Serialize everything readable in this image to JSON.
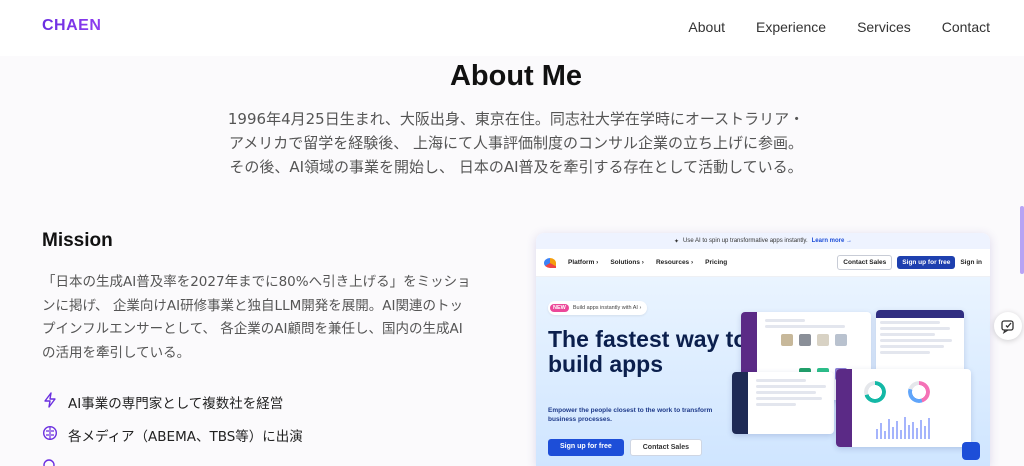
{
  "header": {
    "logo": "CHAEN",
    "nav": [
      "About",
      "Experience",
      "Services",
      "Contact"
    ]
  },
  "about": {
    "title": "About Me",
    "lines": [
      "1996年4月25日生まれ、大阪出身、東京在住。同志社大学在学時にオーストラリア・",
      "アメリカで留学を経験後、 上海にて人事評価制度のコンサル企業の立ち上げに参画。",
      "その後、AI領域の事業を開始し、 日本のAI普及を牽引する存在として活動している。"
    ]
  },
  "mission": {
    "title": "Mission",
    "lines": [
      "「日本の生成AI普及率を2027年までに80%へ引き上げる」をミッショ",
      "ンに掲げ、 企業向けAI研修事業と独自LLM開発を展開。AI関連のトッ",
      "プインフルエンサーとして、 各企業のAI顧問を兼任し、国内の生成AI",
      "の活用を牽引している。"
    ],
    "bullets": [
      {
        "icon": "lightning-icon",
        "text": "AI事業の専門家として複数社を経営"
      },
      {
        "icon": "brain-icon",
        "text": "各メディア（ABEMA、TBS等）に出演"
      }
    ]
  },
  "screenshot": {
    "banner": "Use AI to spin up transformative apps instantly.",
    "banner_link": "Learn more →",
    "menu": [
      "Platform ›",
      "Solutions ›",
      "Resources ›",
      "Pricing"
    ],
    "contact_sales": "Contact Sales",
    "signup": "Sign up for free",
    "signin": "Sign in",
    "pill_new": "NEW",
    "pill_text": "Build apps instantly with AI ›",
    "hero_title": "The fastest way to build apps",
    "hero_sub": "Empower the people closest to the work to transform business processes.",
    "hero_primary": "Sign up for free",
    "hero_secondary": "Contact Sales"
  },
  "colors": {
    "brand": "#6b2fe0",
    "accent_blue": "#1d4ed8",
    "text_muted": "#555555"
  }
}
